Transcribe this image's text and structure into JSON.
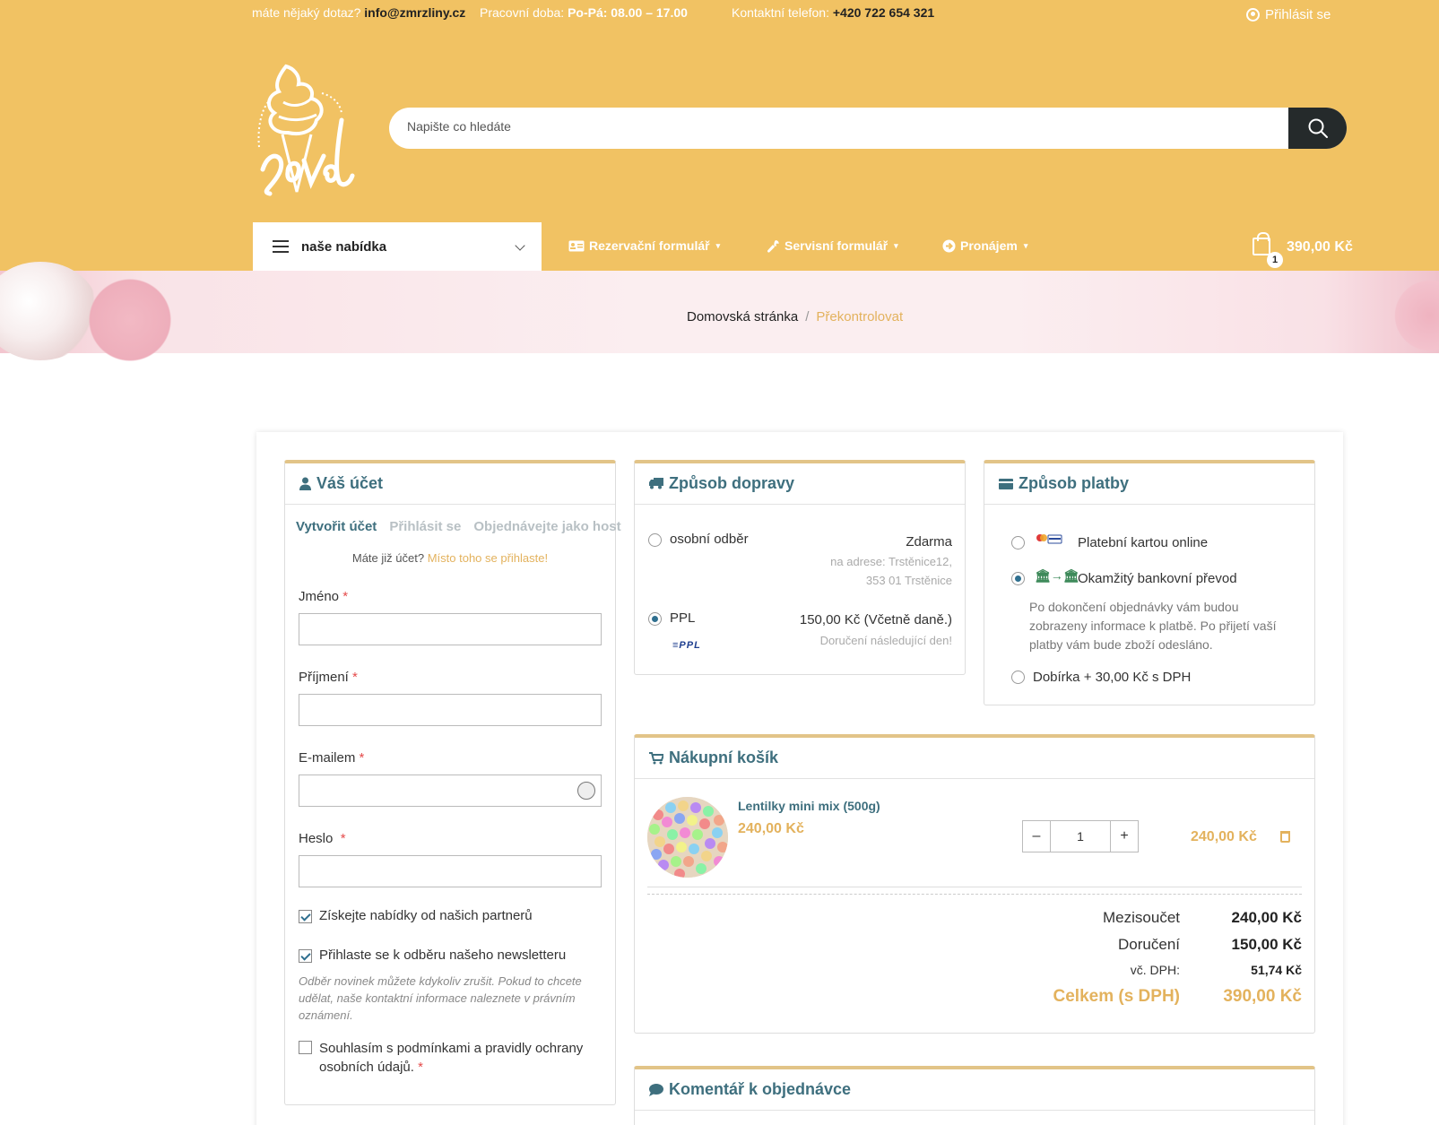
{
  "topbar": {
    "question_prefix": "máte nějaký dotaz?",
    "email": "info@zmrzliny.cz",
    "hours_prefix": "Pracovní doba:",
    "hours": "Po-Pá: 08.00 – 17.00",
    "phone_prefix": "Kontaktní telefon:",
    "phone": "+420 722 654 321",
    "login": "Přihlásit se"
  },
  "search": {
    "placeholder": "Napište co hledáte"
  },
  "nav": {
    "offer": "naše nabídka",
    "links": [
      "Rezervační formulář",
      "Servisní formulář",
      "Pronájem"
    ],
    "cart_count": "1",
    "cart_total": "390,00 Kč"
  },
  "breadcrumb": {
    "home": "Domovská stránka",
    "sep": "/",
    "current": "Překontrolovat"
  },
  "account": {
    "title": "Váš účet",
    "tabs": [
      "Vytvořit účet",
      "Přihlásit se",
      "Objednávejte jako host"
    ],
    "already": "Máte již účet?",
    "already_link": "Místo toho se přihlaste!",
    "fields": [
      "Jméno",
      "Příjmení",
      "E-mailem",
      "Heslo"
    ],
    "req": "*",
    "partners": "Získejte nabídky od našich partnerů",
    "newsletter": "Přihlaste se k odběru našeho newsletteru",
    "note": "Odběr novinek můžete kdykoliv zrušit. Pokud to chcete udělat, naše kontaktní informace naleznete v právním oznámení.",
    "consent": "Souhlasím s podmínkami a pravidly ochrany osobních údajů."
  },
  "shipping": {
    "title": "Způsob dopravy",
    "options": [
      {
        "name": "osobní odběr",
        "price": "Zdarma",
        "sub1": "na adrese: Trstěnice12,",
        "sub2": "353 01 Trstěnice"
      },
      {
        "name": "PPL",
        "price": "150,00 Kč (Včetně daně.)",
        "sub1": "Doručení následující den!",
        "logo": "PPL"
      }
    ]
  },
  "payment": {
    "title": "Způsob platby",
    "options": [
      "Platební kartou online",
      "Okamžitý bankovní převod",
      "Dobírka + 30,00 Kč s DPH"
    ],
    "description": "Po dokončení objednávky vám budou zobrazeny informace k platbě. Po přijetí vaší platby vám bude zboží odesláno."
  },
  "cart": {
    "title": "Nákupní košík",
    "item": {
      "name": "Lentilky mini mix (500g)",
      "price": "240,00 Kč",
      "qty": "1",
      "total": "240,00 Kč"
    },
    "qty_minus": "–",
    "qty_plus": "+",
    "subtotal_label": "Mezisoučet",
    "subtotal": "240,00 Kč",
    "shipping_label": "Doručení",
    "shipping": "150,00 Kč",
    "vat_label": "vč. DPH:",
    "vat": "51,74 Kč",
    "total_label": "Celkem (s DPH)",
    "total": "390,00 Kč"
  },
  "comment": {
    "title": "Komentář k objednávce"
  },
  "colors": {
    "header": "#f1c263",
    "accent": "#e3b25d",
    "teal": "#3e6f7e",
    "dark": "#252a2b"
  }
}
